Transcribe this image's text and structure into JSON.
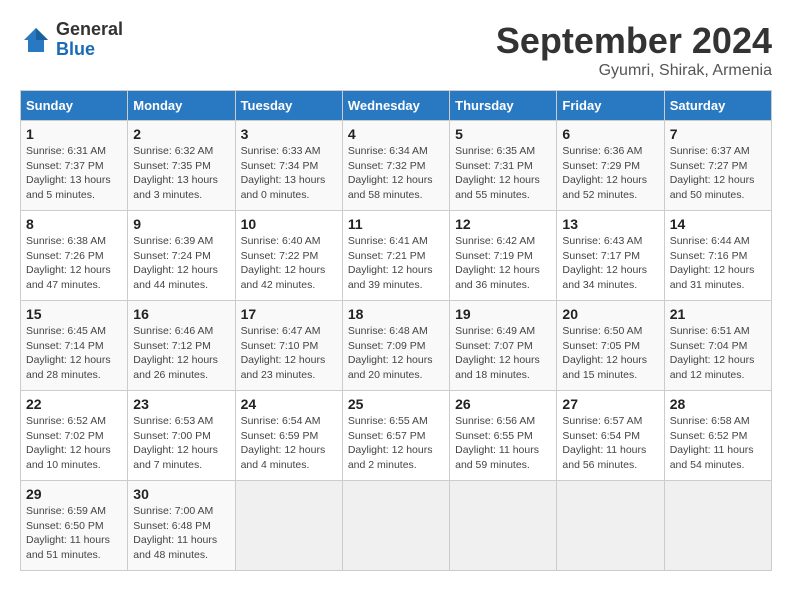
{
  "header": {
    "logo_general": "General",
    "logo_blue": "Blue",
    "month_title": "September 2024",
    "subtitle": "Gyumri, Shirak, Armenia"
  },
  "weekdays": [
    "Sunday",
    "Monday",
    "Tuesday",
    "Wednesday",
    "Thursday",
    "Friday",
    "Saturday"
  ],
  "days": [
    {
      "num": "",
      "info": ""
    },
    {
      "num": "",
      "info": ""
    },
    {
      "num": "",
      "info": ""
    },
    {
      "num": "",
      "info": ""
    },
    {
      "num": "",
      "info": ""
    },
    {
      "num": "",
      "info": ""
    },
    {
      "num": "",
      "info": ""
    },
    {
      "num": "1",
      "info": "Sunrise: 6:31 AM\nSunset: 7:37 PM\nDaylight: 13 hours\nand 5 minutes."
    },
    {
      "num": "2",
      "info": "Sunrise: 6:32 AM\nSunset: 7:35 PM\nDaylight: 13 hours\nand 3 minutes."
    },
    {
      "num": "3",
      "info": "Sunrise: 6:33 AM\nSunset: 7:34 PM\nDaylight: 13 hours\nand 0 minutes."
    },
    {
      "num": "4",
      "info": "Sunrise: 6:34 AM\nSunset: 7:32 PM\nDaylight: 12 hours\nand 58 minutes."
    },
    {
      "num": "5",
      "info": "Sunrise: 6:35 AM\nSunset: 7:31 PM\nDaylight: 12 hours\nand 55 minutes."
    },
    {
      "num": "6",
      "info": "Sunrise: 6:36 AM\nSunset: 7:29 PM\nDaylight: 12 hours\nand 52 minutes."
    },
    {
      "num": "7",
      "info": "Sunrise: 6:37 AM\nSunset: 7:27 PM\nDaylight: 12 hours\nand 50 minutes."
    },
    {
      "num": "8",
      "info": "Sunrise: 6:38 AM\nSunset: 7:26 PM\nDaylight: 12 hours\nand 47 minutes."
    },
    {
      "num": "9",
      "info": "Sunrise: 6:39 AM\nSunset: 7:24 PM\nDaylight: 12 hours\nand 44 minutes."
    },
    {
      "num": "10",
      "info": "Sunrise: 6:40 AM\nSunset: 7:22 PM\nDaylight: 12 hours\nand 42 minutes."
    },
    {
      "num": "11",
      "info": "Sunrise: 6:41 AM\nSunset: 7:21 PM\nDaylight: 12 hours\nand 39 minutes."
    },
    {
      "num": "12",
      "info": "Sunrise: 6:42 AM\nSunset: 7:19 PM\nDaylight: 12 hours\nand 36 minutes."
    },
    {
      "num": "13",
      "info": "Sunrise: 6:43 AM\nSunset: 7:17 PM\nDaylight: 12 hours\nand 34 minutes."
    },
    {
      "num": "14",
      "info": "Sunrise: 6:44 AM\nSunset: 7:16 PM\nDaylight: 12 hours\nand 31 minutes."
    },
    {
      "num": "15",
      "info": "Sunrise: 6:45 AM\nSunset: 7:14 PM\nDaylight: 12 hours\nand 28 minutes."
    },
    {
      "num": "16",
      "info": "Sunrise: 6:46 AM\nSunset: 7:12 PM\nDaylight: 12 hours\nand 26 minutes."
    },
    {
      "num": "17",
      "info": "Sunrise: 6:47 AM\nSunset: 7:10 PM\nDaylight: 12 hours\nand 23 minutes."
    },
    {
      "num": "18",
      "info": "Sunrise: 6:48 AM\nSunset: 7:09 PM\nDaylight: 12 hours\nand 20 minutes."
    },
    {
      "num": "19",
      "info": "Sunrise: 6:49 AM\nSunset: 7:07 PM\nDaylight: 12 hours\nand 18 minutes."
    },
    {
      "num": "20",
      "info": "Sunrise: 6:50 AM\nSunset: 7:05 PM\nDaylight: 12 hours\nand 15 minutes."
    },
    {
      "num": "21",
      "info": "Sunrise: 6:51 AM\nSunset: 7:04 PM\nDaylight: 12 hours\nand 12 minutes."
    },
    {
      "num": "22",
      "info": "Sunrise: 6:52 AM\nSunset: 7:02 PM\nDaylight: 12 hours\nand 10 minutes."
    },
    {
      "num": "23",
      "info": "Sunrise: 6:53 AM\nSunset: 7:00 PM\nDaylight: 12 hours\nand 7 minutes."
    },
    {
      "num": "24",
      "info": "Sunrise: 6:54 AM\nSunset: 6:59 PM\nDaylight: 12 hours\nand 4 minutes."
    },
    {
      "num": "25",
      "info": "Sunrise: 6:55 AM\nSunset: 6:57 PM\nDaylight: 12 hours\nand 2 minutes."
    },
    {
      "num": "26",
      "info": "Sunrise: 6:56 AM\nSunset: 6:55 PM\nDaylight: 11 hours\nand 59 minutes."
    },
    {
      "num": "27",
      "info": "Sunrise: 6:57 AM\nSunset: 6:54 PM\nDaylight: 11 hours\nand 56 minutes."
    },
    {
      "num": "28",
      "info": "Sunrise: 6:58 AM\nSunset: 6:52 PM\nDaylight: 11 hours\nand 54 minutes."
    },
    {
      "num": "29",
      "info": "Sunrise: 6:59 AM\nSunset: 6:50 PM\nDaylight: 11 hours\nand 51 minutes."
    },
    {
      "num": "30",
      "info": "Sunrise: 7:00 AM\nSunset: 6:48 PM\nDaylight: 11 hours\nand 48 minutes."
    },
    {
      "num": "",
      "info": ""
    },
    {
      "num": "",
      "info": ""
    },
    {
      "num": "",
      "info": ""
    },
    {
      "num": "",
      "info": ""
    },
    {
      "num": "",
      "info": ""
    }
  ]
}
